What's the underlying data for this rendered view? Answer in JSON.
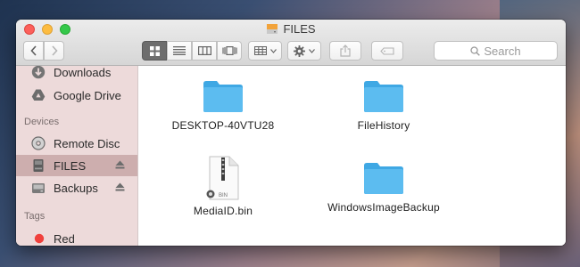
{
  "window": {
    "title": "FILES"
  },
  "toolbar": {
    "view_modes": [
      "icon-view",
      "list-view",
      "column-view",
      "cover-flow-view"
    ],
    "search_placeholder": "Search"
  },
  "sidebar": {
    "favorites": [
      {
        "label": "Downloads",
        "icon": "downloads-icon"
      },
      {
        "label": "Google Drive",
        "icon": "google-drive-icon"
      }
    ],
    "devices_header": "Devices",
    "devices": [
      {
        "label": "Remote Disc",
        "icon": "disc-icon"
      },
      {
        "label": "FILES",
        "icon": "drive-icon",
        "selected": true,
        "eject": true
      },
      {
        "label": "Backups",
        "icon": "drive-icon",
        "eject": true
      }
    ],
    "tags_header": "Tags",
    "tags": [
      {
        "label": "Red",
        "color": "#f0403c"
      }
    ]
  },
  "files": [
    {
      "name": "DESKTOP-40VTU28",
      "type": "folder"
    },
    {
      "name": "FileHistory",
      "type": "folder"
    },
    {
      "name": "MediaID.bin",
      "type": "document",
      "badge": "BIN"
    },
    {
      "name": "WindowsImageBackup",
      "type": "folder"
    }
  ],
  "colors": {
    "folder": "#5cbcf0",
    "folder_tab": "#3fa8e4",
    "selection": "#cdaeae"
  }
}
